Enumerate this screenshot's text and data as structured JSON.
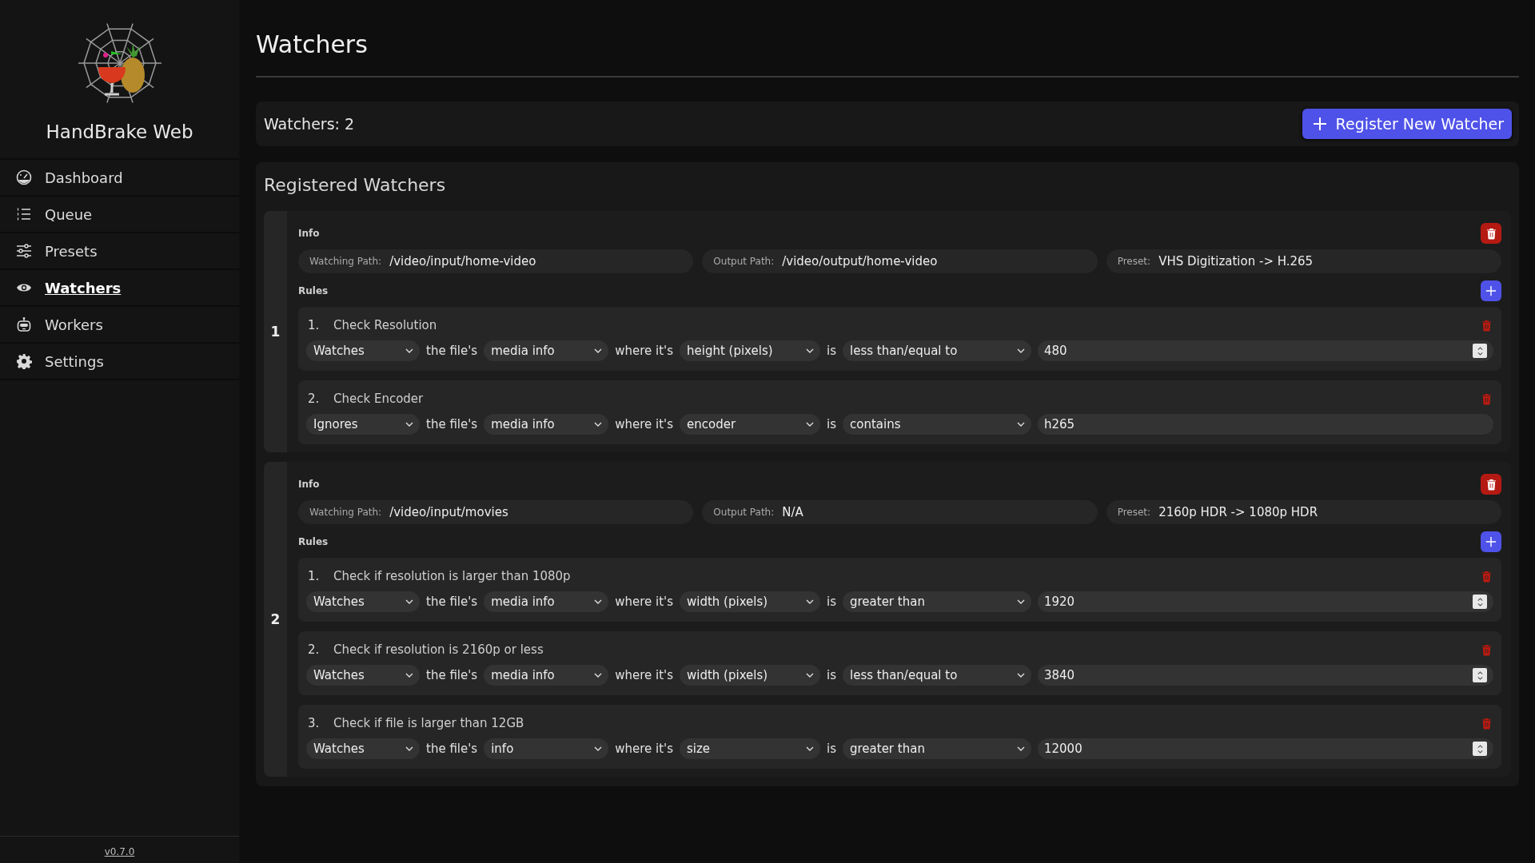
{
  "sidebar": {
    "app_name": "HandBrake Web",
    "items": [
      {
        "label": "Dashboard",
        "selected": false
      },
      {
        "label": "Queue",
        "selected": false
      },
      {
        "label": "Presets",
        "selected": false
      },
      {
        "label": "Watchers",
        "selected": true
      },
      {
        "label": "Workers",
        "selected": false
      },
      {
        "label": "Settings",
        "selected": false
      }
    ],
    "version": "v0.7.0"
  },
  "page": {
    "title": "Watchers"
  },
  "summary": {
    "count_text": "Watchers: 2",
    "register_button": "Register New Watcher"
  },
  "registered": {
    "heading": "Registered Watchers",
    "watchers": [
      {
        "index": "1",
        "info_label": "Info",
        "fields": [
          {
            "label": "Watching Path:",
            "value": "/video/input/home-video"
          },
          {
            "label": "Output Path:",
            "value": "/video/output/home-video"
          },
          {
            "label": "Preset:",
            "value": "VHS Digitization -> H.265"
          }
        ],
        "rules_label": "Rules",
        "rules": [
          {
            "number": "1.",
            "title": "Check Resolution",
            "mode": "Watches",
            "text_1": "the file's",
            "source": "media info",
            "text_2": "where it's",
            "property": "height (pixels)",
            "text_3": "is",
            "comparison": "less than/equal to",
            "value": "480",
            "kind": "number"
          },
          {
            "number": "2.",
            "title": "Check Encoder",
            "mode": "Ignores",
            "text_1": "the file's",
            "source": "media info",
            "text_2": "where it's",
            "property": "encoder",
            "text_3": "is",
            "comparison": "contains",
            "value": "h265",
            "kind": "text"
          }
        ]
      },
      {
        "index": "2",
        "info_label": "Info",
        "fields": [
          {
            "label": "Watching Path:",
            "value": "/video/input/movies"
          },
          {
            "label": "Output Path:",
            "value": "N/A"
          },
          {
            "label": "Preset:",
            "value": "2160p HDR -> 1080p HDR"
          }
        ],
        "rules_label": "Rules",
        "rules": [
          {
            "number": "1.",
            "title": "Check if resolution is larger than 1080p",
            "mode": "Watches",
            "text_1": "the file's",
            "source": "media info",
            "text_2": "where it's",
            "property": "width (pixels)",
            "text_3": "is",
            "comparison": "greater than",
            "value": "1920",
            "kind": "number"
          },
          {
            "number": "2.",
            "title": "Check if resolution is 2160p or less",
            "mode": "Watches",
            "text_1": "the file's",
            "source": "media info",
            "text_2": "where it's",
            "property": "width (pixels)",
            "text_3": "is",
            "comparison": "less than/equal to",
            "value": "3840",
            "kind": "number"
          },
          {
            "number": "3.",
            "title": "Check if file is larger than 12GB",
            "mode": "Watches",
            "text_1": "the file's",
            "source": "info",
            "text_2": "where it's",
            "property": "size",
            "text_3": "is",
            "comparison": "greater than",
            "value": "12000",
            "kind": "number"
          }
        ]
      }
    ]
  }
}
